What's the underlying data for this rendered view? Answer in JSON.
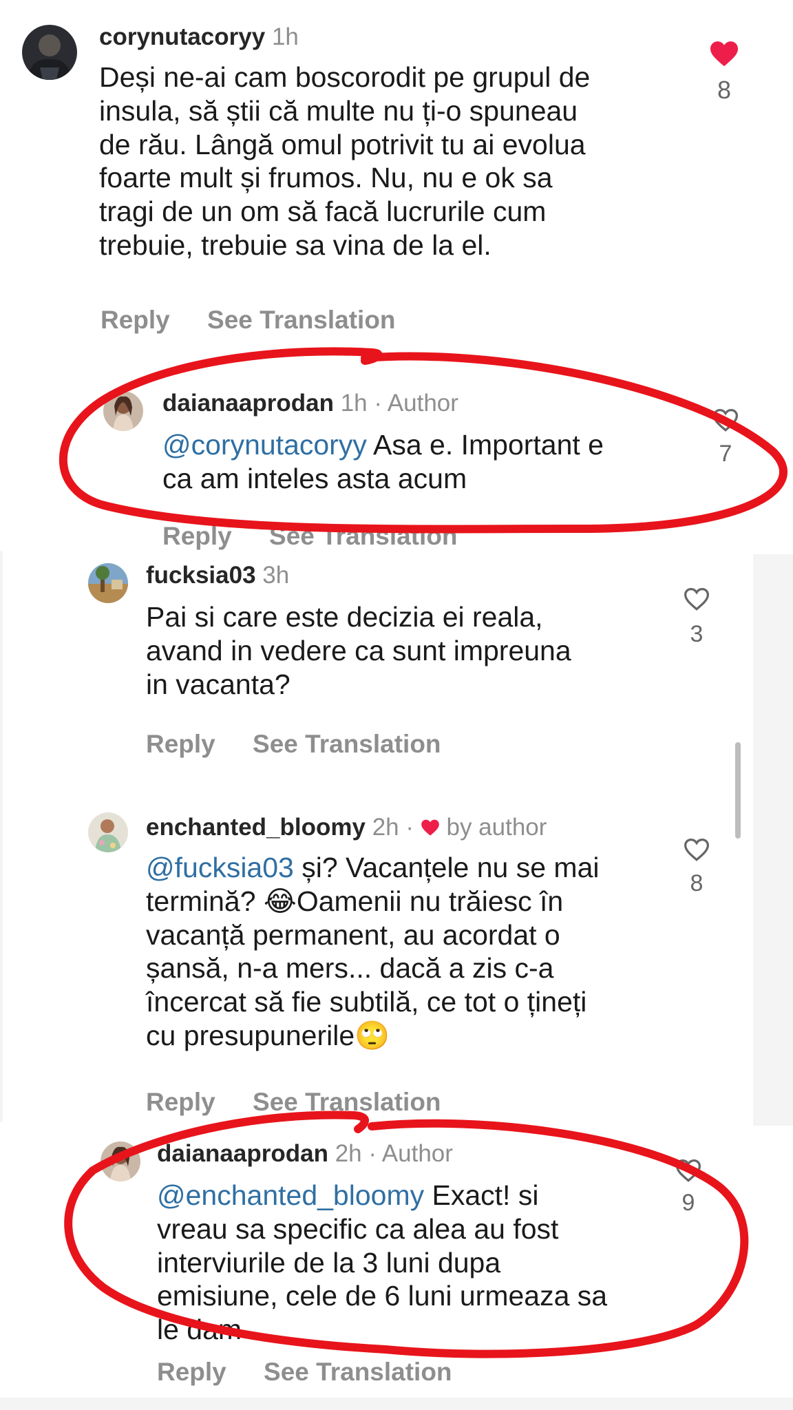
{
  "comments": [
    {
      "username": "corynutacoryy",
      "time": "1h",
      "tag": "",
      "text_lines": [
        "Deși ne-ai cam boscorodit pe grupul de",
        "insula, să știi că multe nu ți-o spuneau",
        "de rău. Lângă omul potrivit tu ai evolua",
        "foarte mult și frumos. Nu, nu e ok sa",
        "tragi de un om să facă lucrurile cum",
        "trebuie, trebuie sa vina de la el."
      ],
      "likes": "8",
      "liked": true,
      "reply_label": "Reply",
      "translate_label": "See Translation"
    },
    {
      "username": "daianaaprodan",
      "time": "1h",
      "tag": "· Author",
      "mention": "@corynutacoryy",
      "text_first_rest": " Asa e. Important e",
      "text_lines": [
        "ca am inteles asta acum"
      ],
      "likes": "7",
      "liked": false,
      "reply_label": "Reply",
      "translate_label": "See Translation"
    },
    {
      "username": "fucksia03",
      "time": "3h",
      "tag": "",
      "text_lines": [
        "Pai si care este decizia ei reala,",
        "avand in vedere ca sunt impreuna",
        "in vacanta?"
      ],
      "likes": "3",
      "liked": false,
      "reply_label": "Reply",
      "translate_label": "See Translation"
    },
    {
      "username": "enchanted_bloomy",
      "time": "2h",
      "tag": "by author",
      "mention": "@fucksia03",
      "text_first_rest": " și? Vacanțele nu se mai",
      "text_lines": [
        "termină? 😂Oamenii nu trăiesc în",
        "vacanță permanent, au acordat o",
        "șansă, n-a mers... dacă a zis c-a",
        "încercat să fie subtilă, ce tot o țineți",
        "cu presupunerile🙄"
      ],
      "likes": "8",
      "liked": false,
      "reply_label": "Reply",
      "translate_label": "See Translation"
    },
    {
      "username": "daianaaprodan",
      "time": "2h",
      "tag": "· Author",
      "mention": "@enchanted_bloomy",
      "text_first_rest": " Exact! si",
      "text_lines": [
        "vreau sa specific ca alea au fost",
        "interviurile de la 3 luni dupa",
        "emisiune, cele de 6 luni urmeaza sa",
        "le dam"
      ],
      "likes": "9",
      "liked": false,
      "reply_label": "Reply",
      "translate_label": "See Translation"
    }
  ],
  "colors": {
    "liked_heart": "#ed1f4a",
    "annotation_red": "#e8141b",
    "mention": "#2f6fa3",
    "muted": "#8e8e8e"
  }
}
